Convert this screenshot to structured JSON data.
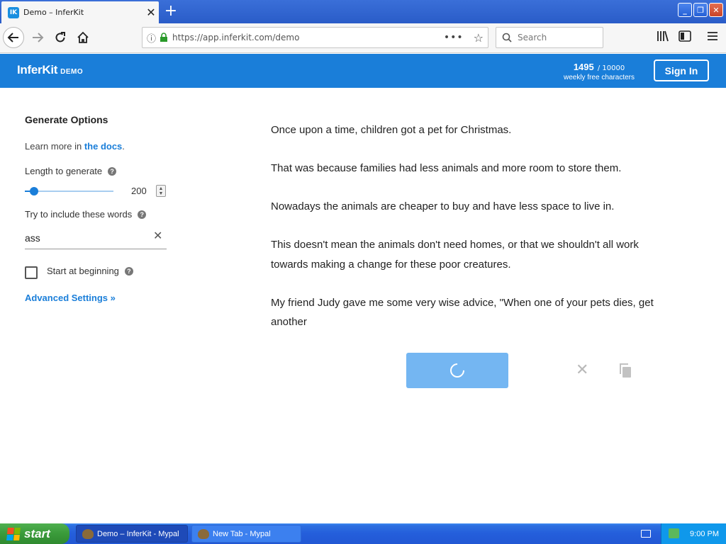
{
  "browser": {
    "tab_title": "Demo – InferKit",
    "tab_favicon": "IK",
    "url": "https://app.inferkit.com/demo",
    "search_placeholder": "Search"
  },
  "header": {
    "brand": "InferKit",
    "brand_suffix": "DEMO",
    "credits_count": "1495",
    "credits_max": "/ 10000",
    "credits_label": "weekly free characters",
    "signin_label": "Sign In"
  },
  "options": {
    "title": "Generate Options",
    "docs_prefix": "Learn more in ",
    "docs_link": "the docs",
    "docs_suffix": ".",
    "length_label": "Length to generate",
    "length_value": "200",
    "length_slider_fraction": 0.1,
    "words_label": "Try to include these words",
    "words_value": "ass",
    "start_label": "Start at beginning",
    "start_checked": false,
    "advanced_link": "Advanced Settings »"
  },
  "output": {
    "paragraphs": [
      "Once upon a time, children got a pet for Christmas.",
      "That was because families had less animals and more room to store them.",
      "Nowadays the animals are cheaper to buy and have less space to live in.",
      "This doesn't mean the animals don't need homes, or that we shouldn't all work towards making a change for these poor creatures.",
      "My friend Judy gave me some very wise advice, \"When one of your pets dies, get another"
    ]
  },
  "taskbar": {
    "start_label": "start",
    "items": [
      {
        "label": "Demo – InferKit - Mypal",
        "active": true
      },
      {
        "label": "New Tab - Mypal",
        "active": false
      }
    ],
    "clock": "9:00 PM"
  },
  "colors": {
    "accent": "#1a7ed9",
    "button_loading": "#74b6f2"
  }
}
